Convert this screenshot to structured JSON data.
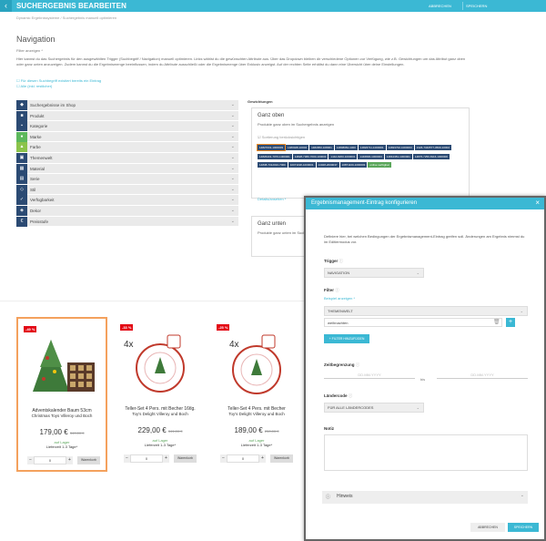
{
  "header": {
    "title": "SUCHERGEBNIS BEARBEITEN",
    "cancel": "ABBRECHEN",
    "save": "SPEICHERN",
    "back_icon": "‹"
  },
  "breadcrumb": "Dynamic Ergebnissysteme  /  Suchergebnis manuell optimieren",
  "navigation": {
    "title": "Navigation",
    "filter_link": "Filter anzeigen *",
    "description": "Hier kannst du das Suchergebnis für den ausgewählten Trigger (Suchbegriff / Navigation) manuell optimieren. Links wählst du die gewünschten Attribute aus. Über das Dropdown bleiben dir verschiedene Optionen zur Verfügung, wie z.B. Gewichtungen um das Attribut ganz oben oder ganz unten anzuzeigen. Zudem kannst du die Ergebnismenge beeinflussen, indem du Attribute ausschließt oder die Ergebnismenge über Exklusiv anzeigst. Auf der rechten Seite erhältst du dann eine Übersicht über deine Einstellungen.",
    "check1": "Für diesen Suchbegriff existiert bereits ein Eintrag",
    "check2": "Alle (inkl. restlicher)"
  },
  "facets": [
    {
      "label": "Suchergebnisse im Shop",
      "icon": "◆"
    },
    {
      "label": "Produkt",
      "icon": "■"
    },
    {
      "label": "Kategorie",
      "icon": "▪"
    },
    {
      "label": "Marke",
      "icon": "●"
    },
    {
      "label": "Farbe",
      "icon": "▲"
    },
    {
      "label": "Themenwelt",
      "icon": "▣"
    },
    {
      "label": "Material",
      "icon": "▦"
    },
    {
      "label": "Serie",
      "icon": "▤"
    },
    {
      "label": "Stil",
      "icon": "◇"
    },
    {
      "label": "Verfügbarkeit",
      "icon": "✓"
    },
    {
      "label": "Dekor",
      "icon": "◈"
    },
    {
      "label": "Preisstufe",
      "icon": "€"
    }
  ],
  "weights": {
    "section": "Gewichtungen",
    "top_title": "Ganz oben",
    "top_sub": "Produkte ganz oben im Suchergebnis anzeigen",
    "top_check": "Sortierung berücksichtigen",
    "more_link": "Details/ansehen *",
    "bottom_title": "Ganz unten",
    "bottom_sub": "Produkte ganz unten im Suchergebnis anzeigen",
    "tags": [
      "14827031-1000003",
      "1483028-10004",
      "1482950-108001",
      "14808082-1000",
      "14826711-1000001",
      "14823702-1000003",
      "1326-7340577-0500-10002",
      "14826431-7070-1000001",
      "14828-7380-7000-100003",
      "1442-8260-1000001",
      "1446836-1000003",
      "14842381-1000001",
      "14876-7250-8116-1000000",
      "14838-7312010-7000",
      "10071198-1000001",
      "14028-2000037",
      "10871100-1000003",
      "online verfügbar"
    ]
  },
  "products": [
    {
      "discount": "-49 %",
      "name": "Adventskalender Baum 53cm",
      "sub": "Christmas Toys Villeroy und Boch",
      "price": "179,00 €",
      "old": "349,00 €",
      "avail": "auf Lager",
      "delivery": "Lieferzeit 1-3 Tage*",
      "qty": "0",
      "cart": "Warenkorb"
    },
    {
      "discount": "-33 %",
      "name": "Teller-Set 4 Pers. mit Becher 16tlg.",
      "sub": "Toy's Delight Villeroy und Boch",
      "price": "229,00 €",
      "old": "341,00 €",
      "avail": "auf Lager",
      "delivery": "Lieferzeit 1-3 Tage*",
      "qty": "0",
      "cart": "Warenkorb",
      "badge": "4x"
    },
    {
      "discount": "-25 %",
      "name": "Teller-Set 4 Pers. mit Becher",
      "sub": "Toy's Delight Villeroy und Boch",
      "price": "189,00 €",
      "old": "250,00 €",
      "avail": "auf Lager",
      "delivery": "Lieferzeit 1-3 Tage*",
      "qty": "0",
      "cart": "Warenkorb",
      "badge": "4x"
    }
  ],
  "modal": {
    "title": "Ergebnismanagement-Eintrag konfigurieren",
    "close": "×",
    "intro": "Definiere hier, bei welchen Bedingungen der Ergebnismanagement-Eintrag greifen soll. Änderungen am Ergebnis nimmst du im Editiermodus vor.",
    "trigger_label": "Trigger",
    "trigger_value": "NAVIGATION",
    "filter_label": "Filter",
    "filter_link": "Beispiel anzeigen *",
    "filter_field": "THEMENWELT",
    "filter_value": "weihnachten",
    "add_filter": "+ FILTER HINZUFÜGEN",
    "time_label": "Zeitbegrenzung",
    "date_ph1": "DD.MM.YYYY",
    "date_sep": "bis",
    "date_ph2": "DD.MM.YYYY",
    "country_label": "Ländercode",
    "country_value": "FÜR ALLE LÄNDERCODES",
    "notes_label": "Notiz",
    "hints": "Hinweis",
    "cancel": "ABBRECHEN",
    "save": "SPEICHERN"
  }
}
